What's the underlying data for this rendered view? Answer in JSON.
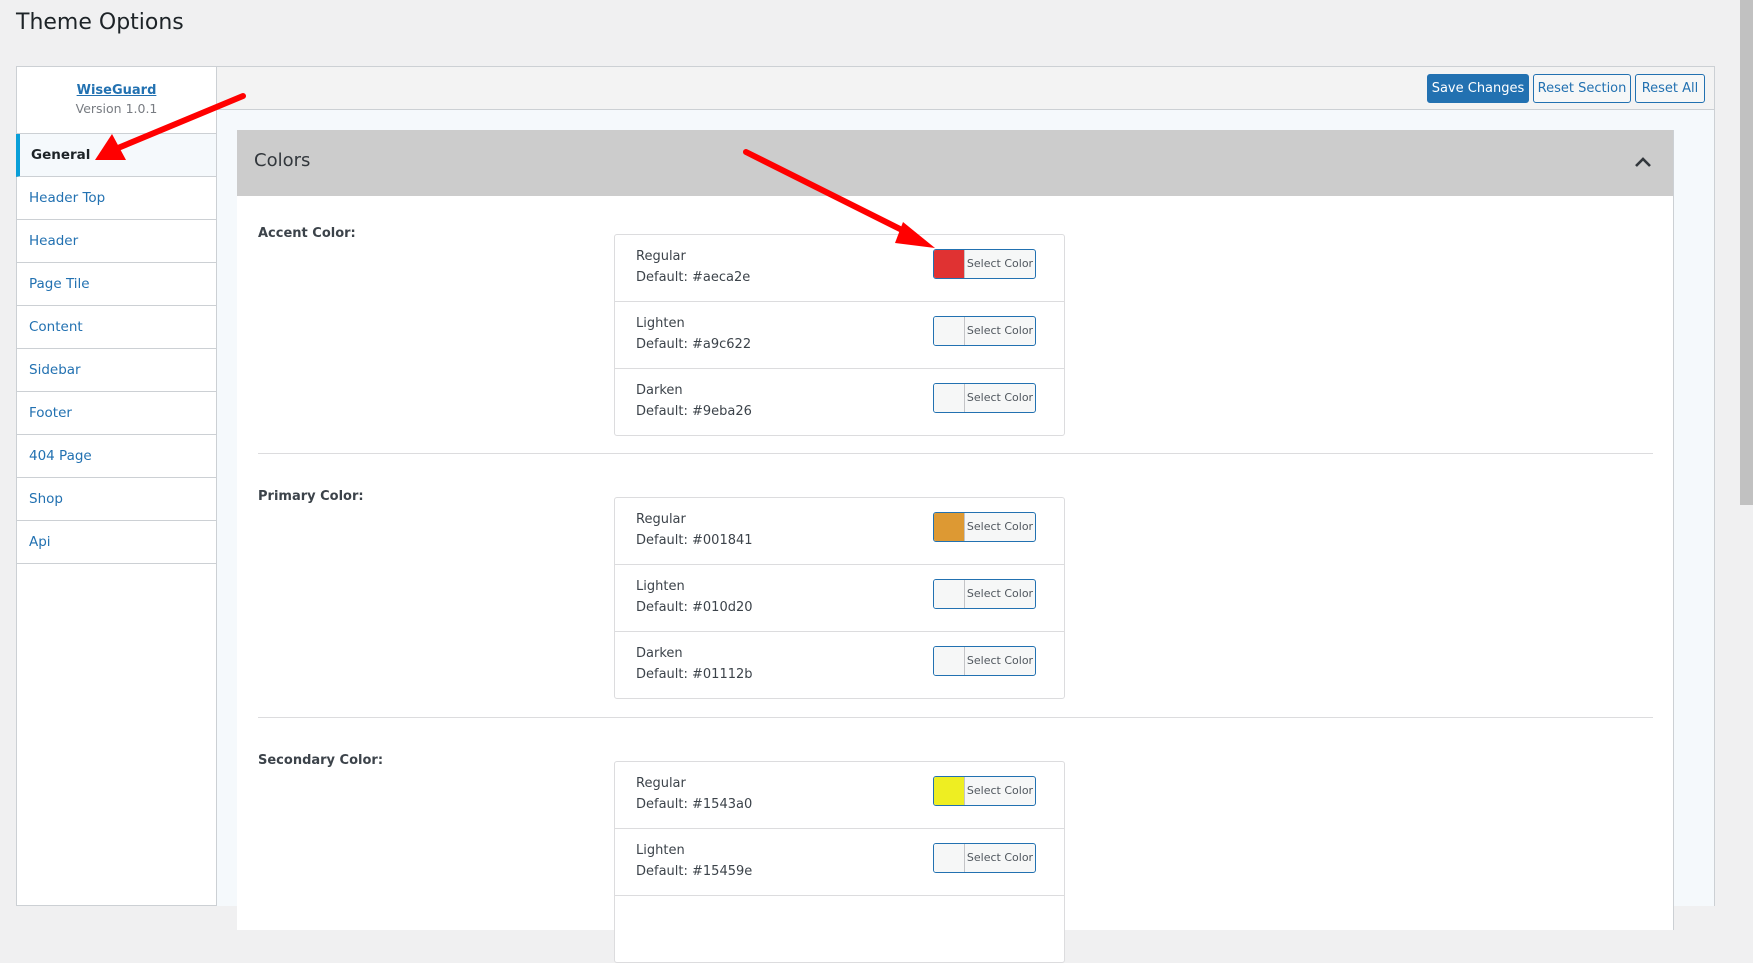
{
  "page": {
    "title": "Theme Options"
  },
  "brand": {
    "name": "WiseGuard",
    "version": "Version 1.0.1"
  },
  "sidebar": {
    "items": [
      {
        "label": "General",
        "active": true
      },
      {
        "label": "Header Top"
      },
      {
        "label": "Header"
      },
      {
        "label": "Page Tile"
      },
      {
        "label": "Content"
      },
      {
        "label": "Sidebar"
      },
      {
        "label": "Footer"
      },
      {
        "label": "404 Page"
      },
      {
        "label": "Shop"
      },
      {
        "label": "Api"
      }
    ]
  },
  "toolbar": {
    "save_label": "Save Changes",
    "reset_section_label": "Reset Section",
    "reset_all_label": "Reset All"
  },
  "section": {
    "title": "Colors",
    "collapse_icon": "chevron-up-icon",
    "groups": [
      {
        "label": "Accent Color:",
        "rows": [
          {
            "name": "Regular",
            "default": "Default: #aeca2e",
            "swatch": "#e03232",
            "button": "Select Color"
          },
          {
            "name": "Lighten",
            "default": "Default: #a9c622",
            "swatch": "#f6f7f7",
            "button": "Select Color"
          },
          {
            "name": "Darken",
            "default": "Default: #9eba26",
            "swatch": "#f6f7f7",
            "button": "Select Color"
          }
        ]
      },
      {
        "label": "Primary Color:",
        "rows": [
          {
            "name": "Regular",
            "default": "Default: #001841",
            "swatch": "#dd9933",
            "button": "Select Color"
          },
          {
            "name": "Lighten",
            "default": "Default: #010d20",
            "swatch": "#f6f7f7",
            "button": "Select Color"
          },
          {
            "name": "Darken",
            "default": "Default: #01112b",
            "swatch": "#f6f7f7",
            "button": "Select Color"
          }
        ]
      },
      {
        "label": "Secondary Color:",
        "rows": [
          {
            "name": "Regular",
            "default": "Default: #1543a0",
            "swatch": "#eeee22",
            "button": "Select Color"
          },
          {
            "name": "Lighten",
            "default": "Default: #15459e",
            "swatch": "#f6f7f7",
            "button": "Select Color"
          },
          {
            "name": "Darken",
            "default": "",
            "swatch": "#f6f7f7",
            "button": ""
          }
        ]
      }
    ]
  },
  "colors": {
    "accent": "#2271b1",
    "annotation_arrow": "#ff0000",
    "active_tab_bar": "#0a9fd8"
  }
}
